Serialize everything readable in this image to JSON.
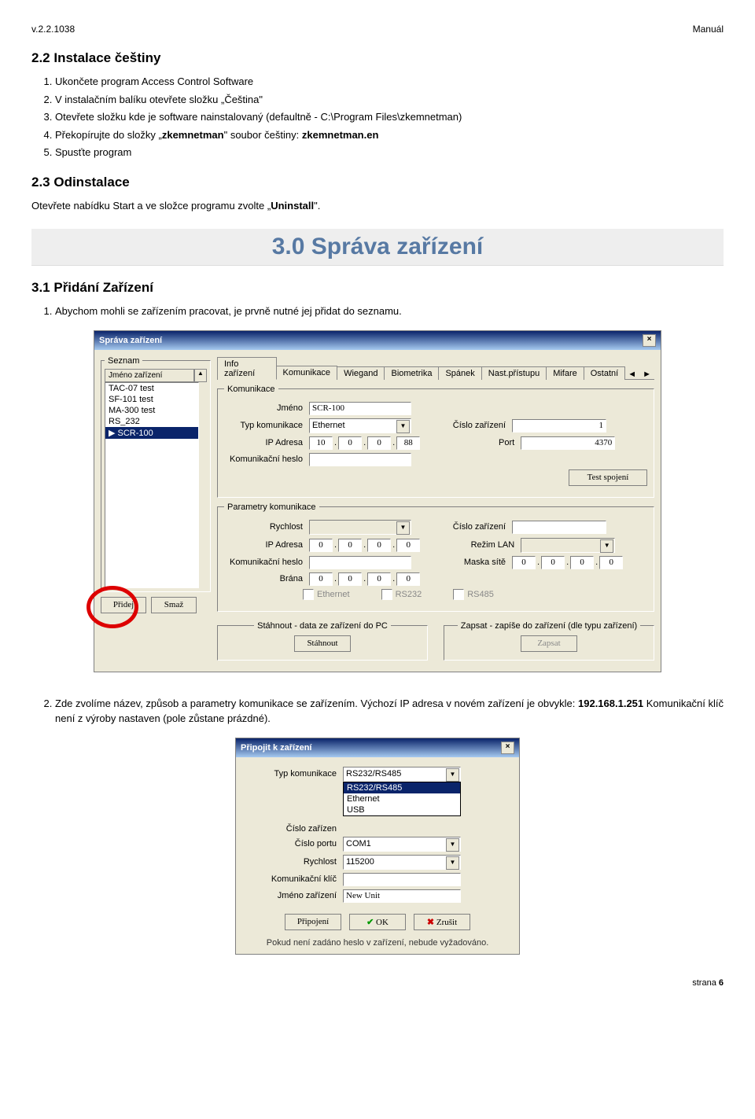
{
  "header": {
    "version": "v.2.2.1038",
    "doctype": "Manuál"
  },
  "s2_2": {
    "title": "2.2 Instalace češtiny",
    "steps": [
      "Ukončete program Access Control Software",
      "V instalačním balíku otevřete složku „Čeština\"",
      "Otevřete složku kde je software nainstalovaný (defaultně - C:\\Program Files\\zkemnetman)",
      "Překopírujte do složky „zkemnetman\" soubor češtiny: zkemnetman.en",
      "Spusťte program"
    ],
    "bold": {
      "3": "zkemnetman",
      "4": "zkemnetman.en"
    }
  },
  "s2_3": {
    "title": "2.3 Odinstalace",
    "text_pre": "Otevřete nabídku Start a ve složce programu zvolte „",
    "text_strong": "Uninstall",
    "text_post": "\"."
  },
  "chapter3": "3.0 Správa zařízení",
  "s3_1": {
    "title": "3.1 Přidání Zařízení",
    "step1": "Abychom mohli se zařízením pracovat, je prvně nutné jej přidat do seznamu.",
    "step2_pre": "Zde zvolíme název, způsob a parametry komunikace se zařízením. Výchozí IP adresa v novém zařízení je obvykle: ",
    "step2_ip": "192.168.1.251",
    "step2_post": "  Komunikační klíč není z výroby nastaven (pole zůstane prázdné)."
  },
  "dlg1": {
    "title": "Správa zařízení",
    "sidebar_group": "Seznam",
    "sidebar_header": "Jméno zařízení",
    "sidebar_items": [
      "TAC-07 test",
      "SF-101 test",
      "MA-300 test",
      "RS_232",
      "SCR-100"
    ],
    "btn_add": "Přidej",
    "btn_del": "Smaž",
    "tabs": [
      "Info zařízení",
      "Komunikace",
      "Wiegand",
      "Biometrika",
      "Spánek",
      "Nast.přístupu",
      "Mifare",
      "Ostatní"
    ],
    "grp_comm": "Komunikace",
    "lbl_name": "Jméno",
    "val_name": "SCR-100",
    "lbl_type": "Typ komunikace",
    "val_type": "Ethernet",
    "lbl_devno": "Číslo zařízení",
    "val_devno": "1",
    "lbl_ip": "IP Adresa",
    "ip": [
      "10",
      "0",
      "0",
      "88"
    ],
    "lbl_port": "Port",
    "val_port": "4370",
    "lbl_commpass": "Komunikační heslo",
    "btn_test": "Test spojení",
    "grp_params": "Parametry komunikace",
    "lbl_speed": "Rychlost",
    "lbl_lan": "Režim LAN",
    "lbl_mask": "Maska sítě",
    "lbl_gw": "Brána",
    "zero_ip": [
      "0",
      "0",
      "0",
      "0"
    ],
    "chk_eth": "Ethernet",
    "chk_232": "RS232",
    "chk_485": "RS485",
    "bottom_dl_label": "Stáhnout - data ze zařízení do PC",
    "bottom_wr_label": "Zapsat - zapíše do zařízení (dle typu zařízení)",
    "btn_dl": "Stáhnout",
    "btn_wr": "Zapsat"
  },
  "dlg2": {
    "title": "Připojit k zařízení",
    "lbl_type": "Typ komunikace",
    "dd_sel": "RS232/RS485",
    "dd_items": [
      "RS232/RS485",
      "Ethernet",
      "USB"
    ],
    "lbl_devno_short": "Číslo zařízen",
    "lbl_portno": "Číslo portu",
    "val_portno": "COM1",
    "lbl_speed": "Rychlost",
    "val_speed": "115200",
    "lbl_commkey": "Komunikační klíč",
    "lbl_devname": "Jméno zařízení",
    "val_devname": "New Unit",
    "btn_conn": "Připojení",
    "btn_ok": "OK",
    "btn_cancel": "Zrušit",
    "note": "Pokud není zadáno heslo v zařízení, nebude vyžadováno."
  },
  "footer": {
    "page": "strana",
    "num": "6"
  }
}
